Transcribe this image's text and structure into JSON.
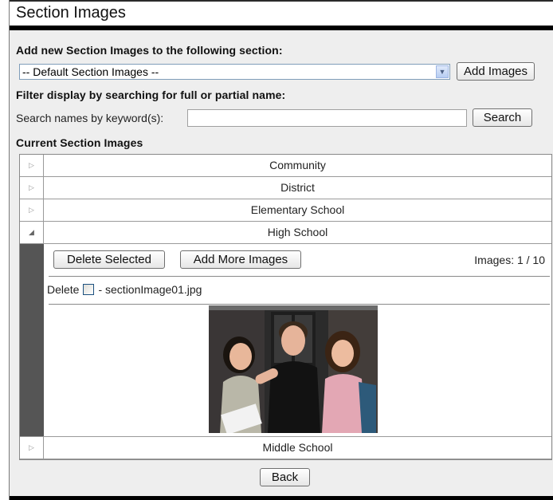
{
  "title": "Section Images",
  "add_section": {
    "label": "Add new Section Images to the following section:",
    "selected_option": "-- Default Section Images --",
    "add_button": "Add Images"
  },
  "filter": {
    "label": "Filter display by searching for full or partial name:",
    "search_label": "Search names by keyword(s):",
    "search_value": "",
    "search_button": "Search"
  },
  "current": {
    "label": "Current Section Images",
    "sections": [
      {
        "name": "Community",
        "expanded": false
      },
      {
        "name": "District",
        "expanded": false
      },
      {
        "name": "Elementary School",
        "expanded": false
      },
      {
        "name": "High School",
        "expanded": true
      },
      {
        "name": "Middle School",
        "expanded": false
      }
    ],
    "expanded_panel": {
      "delete_selected_button": "Delete Selected",
      "add_more_button": "Add More Images",
      "images_count": "Images: 1 / 10",
      "delete_label": "Delete",
      "file_name": "- sectionImage01.jpg"
    }
  },
  "back_button": "Back",
  "icons": {
    "collapsed": "triangle-right-icon",
    "expanded": "triangle-down-icon",
    "dropdown": "chevron-down-icon"
  }
}
